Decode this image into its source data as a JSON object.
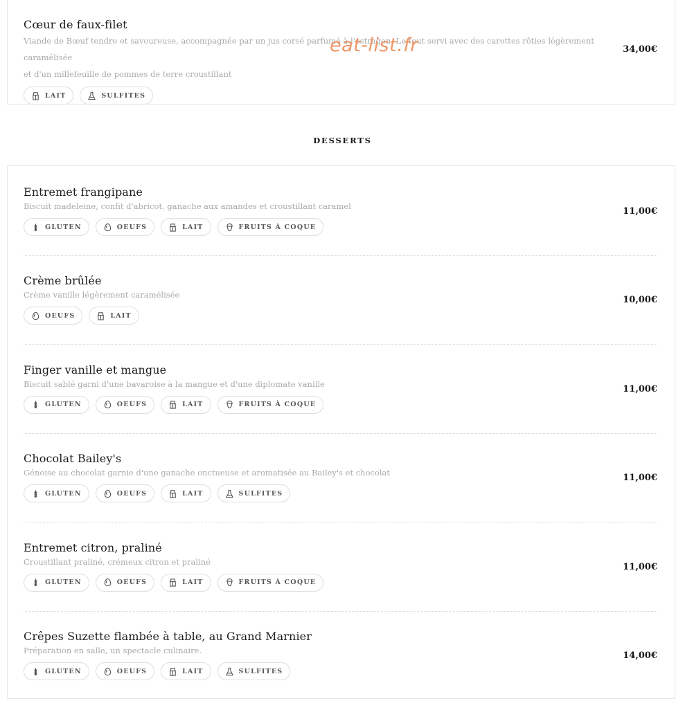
{
  "top_item": {
    "title": "Cœur de faux-filet",
    "desc_line1": "Viande de Bœuf tendre et savoureuse, accompagnée par un jus corsé parfumé à l'estragon. Le tout servi avec des carottes rôties légèrement caramélisée",
    "desc_line2": "et d'un millefeuille de pommes de terre croustillant",
    "price": "34,00€",
    "tags": [
      {
        "label": "LAIT",
        "icon": "milk-icon"
      },
      {
        "label": "SULFITES",
        "icon": "flask-icon"
      }
    ]
  },
  "watermark": "eat-list.fr",
  "section": {
    "title": "DESSERTS"
  },
  "desserts": [
    {
      "title": "Entremet frangipane",
      "desc": "Biscuit madeleine, confit d'abricot, ganache aux amandes et croustillant caramel",
      "price": "11,00€",
      "tags": [
        {
          "label": "GLUTEN",
          "icon": "wheat-icon"
        },
        {
          "label": "OEUFS",
          "icon": "egg-icon"
        },
        {
          "label": "LAIT",
          "icon": "milk-icon"
        },
        {
          "label": "FRUITS À COQUE",
          "icon": "nut-icon"
        }
      ]
    },
    {
      "title": "Crème brûlée",
      "desc": "Crème vanille légèrement caramélisée",
      "price": "10,00€",
      "tags": [
        {
          "label": "OEUFS",
          "icon": "egg-icon"
        },
        {
          "label": "LAIT",
          "icon": "milk-icon"
        }
      ]
    },
    {
      "title": "Finger vanille et mangue",
      "desc": "Biscuit sablé garni d'une bavaroise à la mangue et d'une diplomate vanille",
      "price": "11,00€",
      "tags": [
        {
          "label": "GLUTEN",
          "icon": "wheat-icon"
        },
        {
          "label": "OEUFS",
          "icon": "egg-icon"
        },
        {
          "label": "LAIT",
          "icon": "milk-icon"
        },
        {
          "label": "FRUITS À COQUE",
          "icon": "nut-icon"
        }
      ]
    },
    {
      "title": "Chocolat Bailey's",
      "desc": "Génoise au chocolat garnie d'une ganache onctueuse et aromatisée au Bailey's et chocolat",
      "price": "11,00€",
      "tags": [
        {
          "label": "GLUTEN",
          "icon": "wheat-icon"
        },
        {
          "label": "OEUFS",
          "icon": "egg-icon"
        },
        {
          "label": "LAIT",
          "icon": "milk-icon"
        },
        {
          "label": "SULFITES",
          "icon": "flask-icon"
        }
      ]
    },
    {
      "title": "Entremet citron, praliné",
      "desc": "Croustillant praliné, crémeux citron et praliné",
      "price": "11,00€",
      "tags": [
        {
          "label": "GLUTEN",
          "icon": "wheat-icon"
        },
        {
          "label": "OEUFS",
          "icon": "egg-icon"
        },
        {
          "label": "LAIT",
          "icon": "milk-icon"
        },
        {
          "label": "FRUITS À COQUE",
          "icon": "nut-icon"
        }
      ]
    },
    {
      "title": "Crêpes Suzette flambée à table, au Grand Marnier",
      "desc": "Préparation en salle, un spectacle culinaire.",
      "price": "14,00€",
      "tags": [
        {
          "label": "GLUTEN",
          "icon": "wheat-icon"
        },
        {
          "label": "OEUFS",
          "icon": "egg-icon"
        },
        {
          "label": "LAIT",
          "icon": "milk-icon"
        },
        {
          "label": "SULFITES",
          "icon": "flask-icon"
        }
      ]
    }
  ]
}
